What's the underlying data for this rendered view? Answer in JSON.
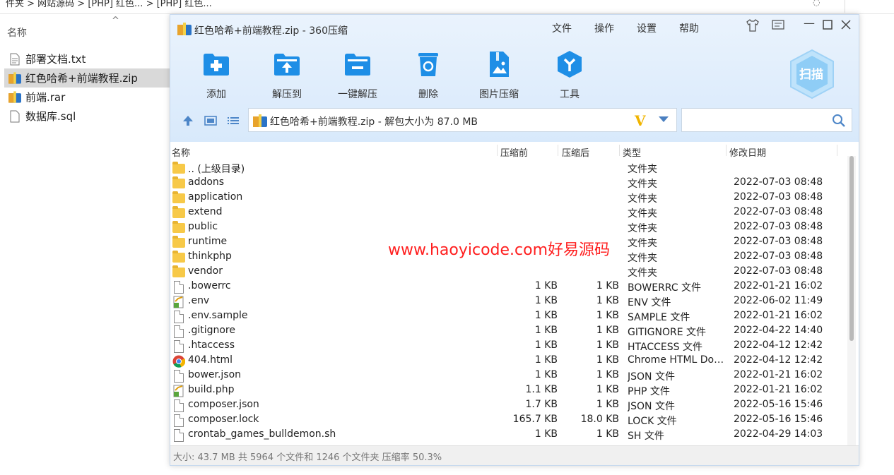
{
  "explorer": {
    "breadcrumb": "件夹 > 网站源码 > [PHP] 红色... > [PHP] 红色...",
    "column_header": "名称",
    "items": [
      {
        "name": "部署文档.txt",
        "icon": "text-file-icon",
        "selected": false
      },
      {
        "name": "红色哈希+前端教程.zip",
        "icon": "archive-icon",
        "selected": true
      },
      {
        "name": "前端.rar",
        "icon": "archive-icon",
        "selected": false
      },
      {
        "name": "数据库.sql",
        "icon": "file-icon",
        "selected": false
      }
    ]
  },
  "window": {
    "title": "红色哈希+前端教程.zip - 360压缩",
    "menu": [
      "文件",
      "操作",
      "设置",
      "帮助"
    ],
    "toolbar": [
      {
        "label": "添加",
        "icon": "add-icon"
      },
      {
        "label": "解压到",
        "icon": "extract-to-icon"
      },
      {
        "label": "一键解压",
        "icon": "one-click-extract-icon"
      },
      {
        "label": "删除",
        "icon": "delete-icon"
      },
      {
        "label": "图片压缩",
        "icon": "image-compress-icon"
      },
      {
        "label": "工具",
        "icon": "tools-icon"
      }
    ],
    "scan_label": "扫描",
    "address": "红色哈希+前端教程.zip - 解包大小为 87.0 MB",
    "search_placeholder": "",
    "columns": {
      "name": "名称",
      "before": "压缩前",
      "after": "压缩后",
      "type": "类型",
      "date": "修改日期"
    },
    "rows": [
      {
        "name": ".. (上级目录)",
        "kind": "folder",
        "before": "",
        "after": "",
        "type": "文件夹",
        "date": ""
      },
      {
        "name": "addons",
        "kind": "folder",
        "before": "",
        "after": "",
        "type": "文件夹",
        "date": "2022-07-03 08:48"
      },
      {
        "name": "application",
        "kind": "folder",
        "before": "",
        "after": "",
        "type": "文件夹",
        "date": "2022-07-03 08:48"
      },
      {
        "name": "extend",
        "kind": "folder",
        "before": "",
        "after": "",
        "type": "文件夹",
        "date": "2022-07-03 08:48"
      },
      {
        "name": "public",
        "kind": "folder",
        "before": "",
        "after": "",
        "type": "文件夹",
        "date": "2022-07-03 08:48"
      },
      {
        "name": "runtime",
        "kind": "folder",
        "before": "",
        "after": "",
        "type": "文件夹",
        "date": "2022-07-03 08:48"
      },
      {
        "name": "thinkphp",
        "kind": "folder",
        "before": "",
        "after": "",
        "type": "文件夹",
        "date": "2022-07-03 08:48"
      },
      {
        "name": "vendor",
        "kind": "folder",
        "before": "",
        "after": "",
        "type": "文件夹",
        "date": "2022-07-03 08:48"
      },
      {
        "name": ".bowerrc",
        "kind": "file",
        "before": "1 KB",
        "after": "1 KB",
        "type": "BOWERRC 文件",
        "date": "2022-01-21 16:02"
      },
      {
        "name": ".env",
        "kind": "php",
        "before": "1 KB",
        "after": "1 KB",
        "type": "ENV 文件",
        "date": "2022-06-02 11:49"
      },
      {
        "name": ".env.sample",
        "kind": "file",
        "before": "1 KB",
        "after": "1 KB",
        "type": "SAMPLE 文件",
        "date": "2022-01-21 16:02"
      },
      {
        "name": ".gitignore",
        "kind": "file",
        "before": "1 KB",
        "after": "1 KB",
        "type": "GITIGNORE 文件",
        "date": "2022-04-22 14:40"
      },
      {
        "name": ".htaccess",
        "kind": "file",
        "before": "1 KB",
        "after": "1 KB",
        "type": "HTACCESS 文件",
        "date": "2022-04-12 12:42"
      },
      {
        "name": "404.html",
        "kind": "chrome",
        "before": "1 KB",
        "after": "1 KB",
        "type": "Chrome HTML Doc...",
        "date": "2022-04-12 12:42"
      },
      {
        "name": "bower.json",
        "kind": "file",
        "before": "1 KB",
        "after": "1 KB",
        "type": "JSON 文件",
        "date": "2022-01-21 16:02"
      },
      {
        "name": "build.php",
        "kind": "php",
        "before": "1.1 KB",
        "after": "1 KB",
        "type": "PHP 文件",
        "date": "2022-01-21 16:02"
      },
      {
        "name": "composer.json",
        "kind": "file",
        "before": "1.7 KB",
        "after": "1 KB",
        "type": "JSON 文件",
        "date": "2022-05-16 15:46"
      },
      {
        "name": "composer.lock",
        "kind": "file",
        "before": "165.7 KB",
        "after": "18.0 KB",
        "type": "LOCK 文件",
        "date": "2022-05-16 15:46"
      },
      {
        "name": "crontab_games_bulldemon.sh",
        "kind": "file",
        "before": "1 KB",
        "after": "1 KB",
        "type": "SH 文件",
        "date": "2022-04-29 14:03"
      }
    ],
    "status": "大小: 43.7 MB 共 5964 个文件和 1246 个文件夹 压缩率 50.3%"
  },
  "watermark": "www.haoyicode.com好易源码",
  "colors": {
    "accent": "#1e8ee6",
    "folder": "#f7c948",
    "watermark": "#ff1e1e"
  }
}
